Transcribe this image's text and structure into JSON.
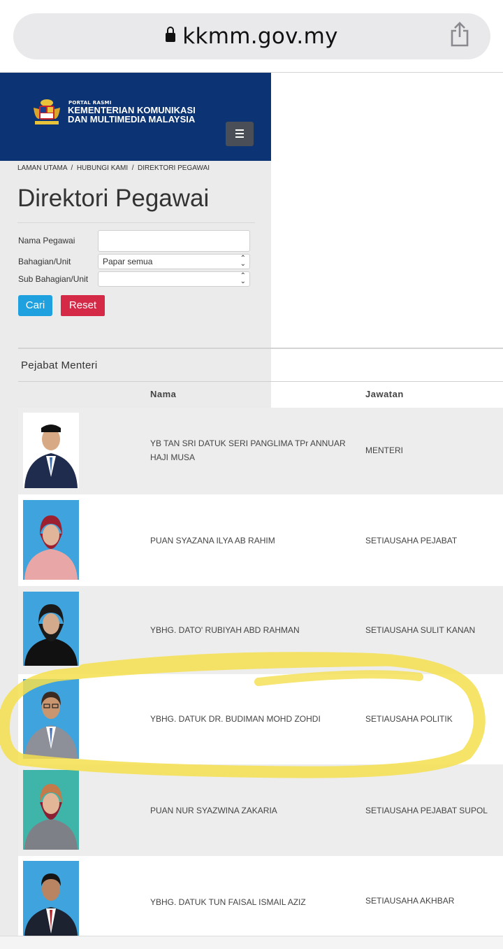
{
  "browser": {
    "url": "kkmm.gov.my"
  },
  "site": {
    "portal_small": "PORTAL RASMI",
    "portal_line1": "KEMENTERIAN KOMUNIKASI",
    "portal_line2": "DAN MULTIMEDIA MALAYSIA"
  },
  "breadcrumb": {
    "text": "LAMAN UTAMA  /  HUBUNGI KAMI  /  DIREKTORI PEGAWAI"
  },
  "page": {
    "title": "Direktori Pegawai"
  },
  "form": {
    "nama_label": "Nama Pegawai",
    "nama_value": "",
    "bahagian_label": "Bahagian/Unit",
    "bahagian_value": "Papar semua",
    "sub_label": "Sub Bahagian/Unit",
    "sub_value": "",
    "cari_label": "Cari",
    "reset_label": "Reset"
  },
  "section": {
    "title": "Pejabat Menteri",
    "col_nama": "Nama",
    "col_jawatan": "Jawatan"
  },
  "rows": [
    {
      "name": "YB TAN SRI DATUK SERI PANGLIMA TPr ANNUAR HAJI MUSA",
      "position": "MENTERI"
    },
    {
      "name": "PUAN SYAZANA ILYA AB RAHIM",
      "position": "SETIAUSAHA PEJABAT"
    },
    {
      "name": "YBHG. DATO' RUBIYAH ABD RAHMAN",
      "position": "SETIAUSAHA SULIT KANAN"
    },
    {
      "name": "YBHG. DATUK DR. BUDIMAN MOHD ZOHDI",
      "position": "SETIAUSAHA POLITIK"
    },
    {
      "name": "PUAN NUR SYAZWINA ZAKARIA",
      "position": "SETIAUSAHA PEJABAT SUPOL"
    },
    {
      "name": "YBHG. DATUK TUN FAISAL ISMAIL AZIZ",
      "position": "SETIAUSAHA AKHBAR"
    }
  ],
  "colors": {
    "header_blue": "#0c3373",
    "cari_blue": "#1fa0df",
    "reset_red": "#d42a47",
    "highlight_yellow": "#f4df4d"
  }
}
